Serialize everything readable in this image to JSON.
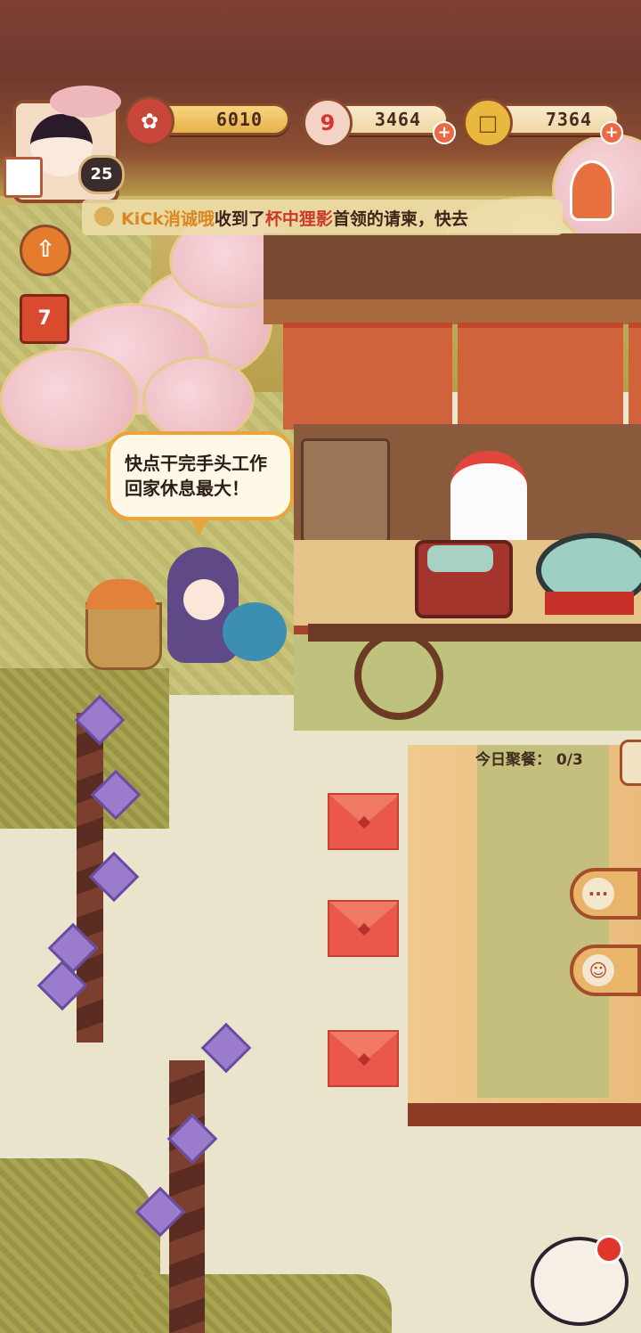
{
  "hud": {
    "level": "25",
    "currency_plum": "6010",
    "currency_magatama": "3464",
    "currency_coin": "7364",
    "plum_icon": "plum-blossom-icon",
    "magatama_icon": "magatama-icon",
    "coin_icon": "coin-icon",
    "plus_symbol": "+"
  },
  "marquee": {
    "player": "KiCk消诚哦",
    "text_a": "收到了",
    "request_source": "杯中狸影",
    "text_b": "首领的请柬，快去"
  },
  "left_buttons": {
    "calendar_day": "7",
    "up_icon": "arrow-up-lantern-icon",
    "calendar_icon": "calendar-icon"
  },
  "speech": {
    "line1": "快点干完手头工作",
    "line2": "回家休息最大！"
  },
  "table": {
    "today_label": "今日聚餐：",
    "today_count": "0/3"
  },
  "side_buttons": {
    "chat_icon": "chat-bubble-icon",
    "character_icon": "character-icon"
  },
  "colors": {
    "accent_orange": "#e9a43c",
    "envelope_red": "#e9584a",
    "highlight_player": "#d98624",
    "highlight_request": "#c93a2d"
  }
}
